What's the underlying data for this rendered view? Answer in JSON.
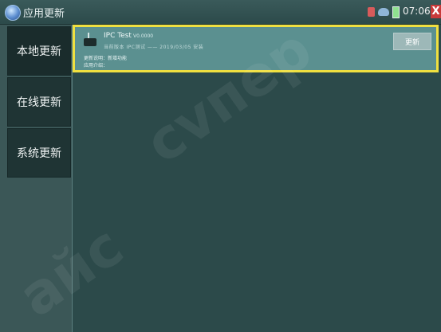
{
  "window": {
    "title": "应用更新",
    "time": "07:06",
    "close_glyph": "X"
  },
  "icons": {
    "app": "app-update-icon",
    "usb": "usb-icon",
    "network": "network-icon",
    "battery": "battery-icon",
    "close": "close-icon"
  },
  "sidebar": {
    "items": [
      {
        "label": "本地更新"
      },
      {
        "label": "在线更新"
      },
      {
        "label": "系统更新"
      }
    ]
  },
  "main": {
    "item": {
      "name": "IPC Test",
      "version": "V0.0000",
      "subinfo": "当前版本  IPC测试  ——  2019/03/05  安装",
      "line1": "更新说明：新增功能",
      "line2": "应用介绍：",
      "update_label": "更新"
    }
  },
  "watermark": {
    "text1": "сvпер",
    "text2": "айс"
  },
  "colors": {
    "highlight_border": "#f0e040",
    "item_bg": "#5b9090",
    "close_bg": "#c83a3a"
  }
}
